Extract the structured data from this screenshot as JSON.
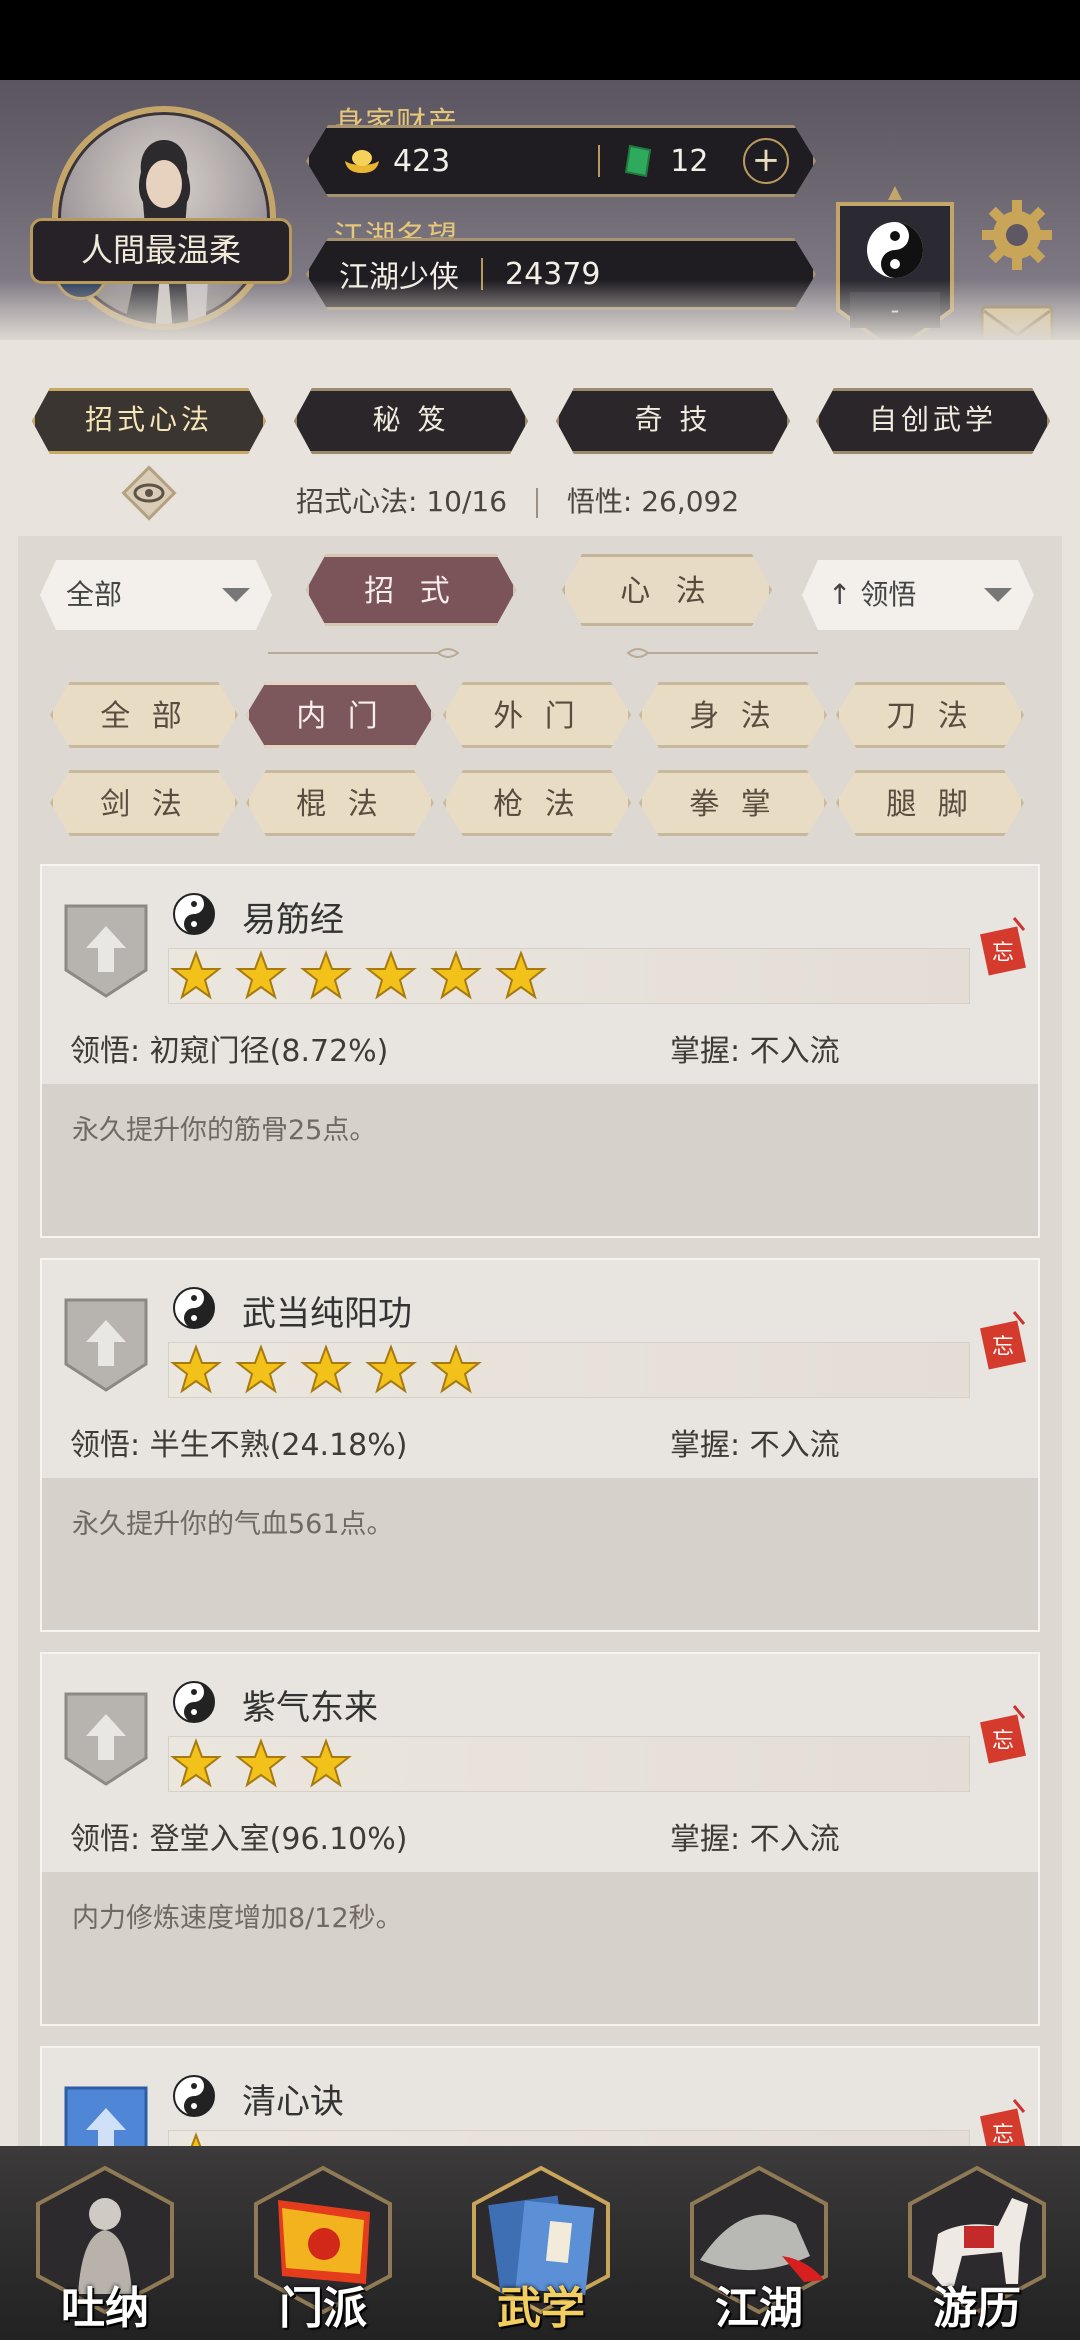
{
  "profile": {
    "name": "人間最温柔",
    "gender_symbol": "♂",
    "wealth_label": "身家财产",
    "gold": "423",
    "jade": "12",
    "plus": "+",
    "fame_label": "江湖名望",
    "fame_title": "江湖少侠",
    "fame_value": "24379",
    "emblem_text": "-"
  },
  "categories": [
    {
      "label": "招式心法",
      "active": true
    },
    {
      "label": "秘 笈",
      "active": false
    },
    {
      "label": "奇 技",
      "active": false
    },
    {
      "label": "自创武学",
      "active": false
    }
  ],
  "stats": {
    "moves_label": "招式心法:",
    "moves_value": "10/16",
    "insight_label": "悟性:",
    "insight_value": "26,092"
  },
  "toolbar": {
    "filter_dropdown": "全部",
    "mode_tabs": [
      "招 式",
      "心 法"
    ],
    "sort_arrow": "↑",
    "sort_dropdown": "领悟"
  },
  "filters": [
    {
      "label": "全 部",
      "active": false
    },
    {
      "label": "内 门",
      "active": true
    },
    {
      "label": "外 门",
      "active": false
    },
    {
      "label": "身 法",
      "active": false
    },
    {
      "label": "刀 法",
      "active": false
    },
    {
      "label": "剑 法",
      "active": false
    },
    {
      "label": "棍 法",
      "active": false
    },
    {
      "label": "枪 法",
      "active": false
    },
    {
      "label": "拳 掌",
      "active": false
    },
    {
      "label": "腿 脚",
      "active": false
    }
  ],
  "skills": [
    {
      "name": "易筋经",
      "stars": 6,
      "insight_label": "领悟:",
      "insight": "初窥门径(8.72%)",
      "mastery_label": "掌握:",
      "mastery": "不入流",
      "desc": "永久提升你的筋骨25点。",
      "shield_color": "grey"
    },
    {
      "name": "武当纯阳功",
      "stars": 5,
      "insight_label": "领悟:",
      "insight": "半生不熟(24.18%)",
      "mastery_label": "掌握:",
      "mastery": "不入流",
      "desc": "永久提升你的气血561点。",
      "shield_color": "grey"
    },
    {
      "name": "紫气东来",
      "stars": 3,
      "insight_label": "领悟:",
      "insight": "登堂入室(96.10%)",
      "mastery_label": "掌握:",
      "mastery": "不入流",
      "desc": "内力修炼速度增加8/12秒。",
      "shield_color": "grey"
    },
    {
      "name": "清心诀",
      "stars": 1,
      "insight_label": "",
      "insight": "",
      "mastery_label": "",
      "mastery": "",
      "desc": "",
      "shield_color": "blue"
    }
  ],
  "nav": [
    {
      "label": "吐纳",
      "active": false
    },
    {
      "label": "门派",
      "active": false
    },
    {
      "label": "武学",
      "active": true
    },
    {
      "label": "江湖",
      "active": false
    },
    {
      "label": "游历",
      "active": false
    }
  ],
  "colors": {
    "accent_gold": "#c5a66a",
    "active_tab": "#7b5459",
    "star": "#f2c21b"
  }
}
